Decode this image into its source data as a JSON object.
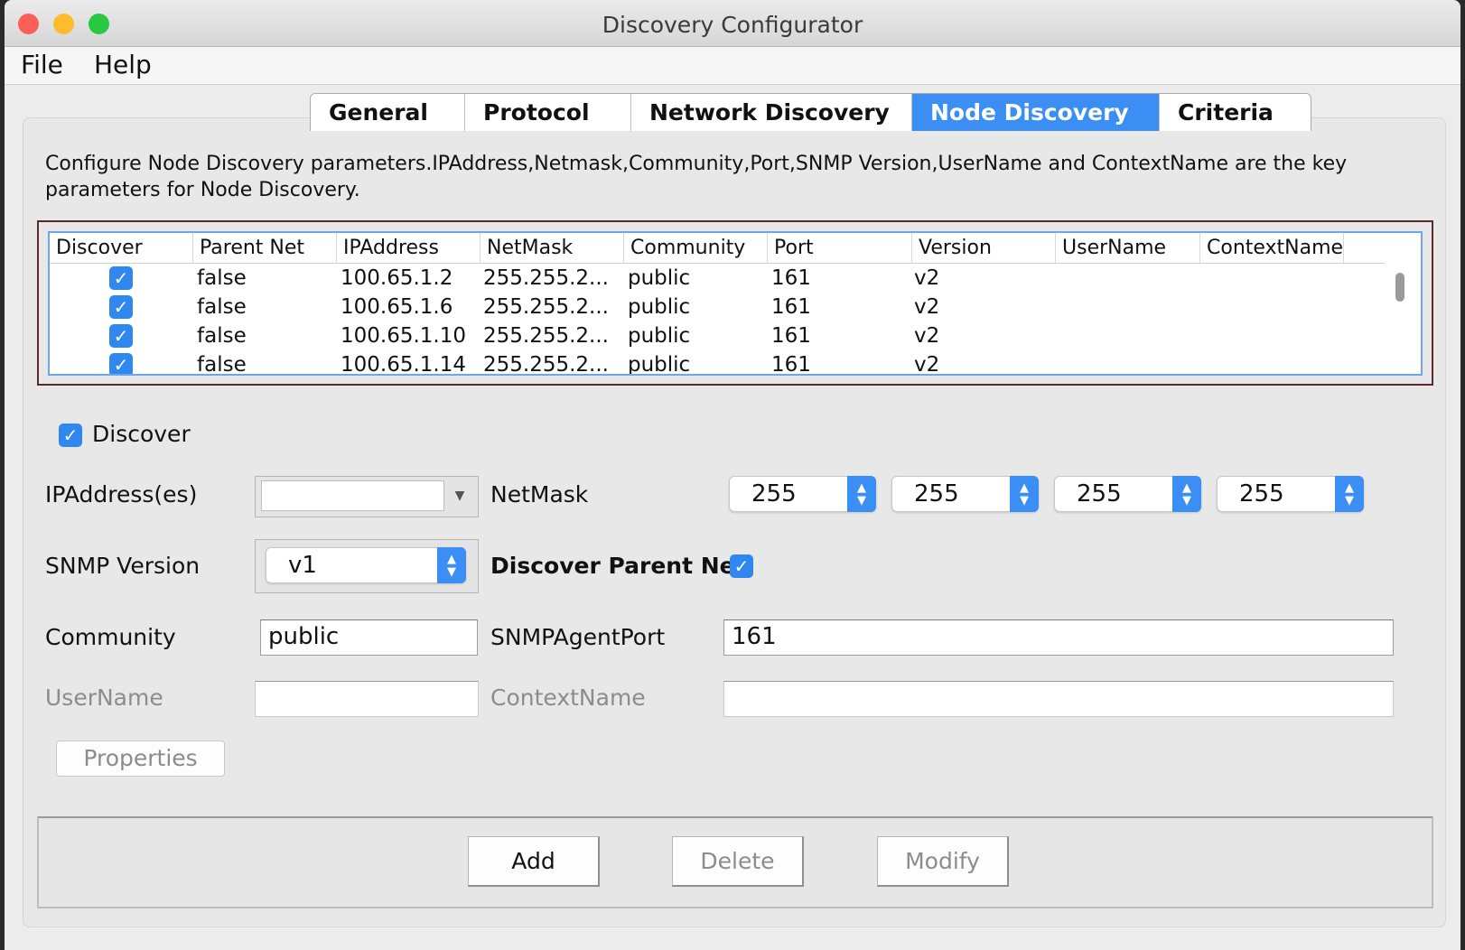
{
  "window": {
    "title": "Discovery Configurator",
    "traffic_lights": {
      "close": "#fc5f57",
      "minimize": "#fdbc2e",
      "zoom": "#28c840"
    }
  },
  "menu": {
    "file": "File",
    "help": "Help"
  },
  "tabs": [
    {
      "label": "General",
      "active": false
    },
    {
      "label": "Protocol",
      "active": false
    },
    {
      "label": "Network Discovery",
      "active": false
    },
    {
      "label": "Node Discovery",
      "active": true
    },
    {
      "label": "Criteria",
      "active": false
    }
  ],
  "description": "Configure Node Discovery parameters.IPAddress,Netmask,Community,Port,SNMP Version,UserName and ContextName are the key parameters for Node Discovery.",
  "table": {
    "columns": [
      "Discover",
      "Parent Net",
      "IPAddress",
      "NetMask",
      "Community",
      "Port",
      "Version",
      "UserName",
      "ContextName"
    ],
    "rows": [
      {
        "discover": true,
        "parent_net": "false",
        "ip": "100.65.1.2",
        "netmask": "255.255.2...",
        "community": "public",
        "port": "161",
        "version": "v2",
        "username": "",
        "contextname": ""
      },
      {
        "discover": true,
        "parent_net": "false",
        "ip": "100.65.1.6",
        "netmask": "255.255.2...",
        "community": "public",
        "port": "161",
        "version": "v2",
        "username": "",
        "contextname": ""
      },
      {
        "discover": true,
        "parent_net": "false",
        "ip": "100.65.1.10",
        "netmask": "255.255.2...",
        "community": "public",
        "port": "161",
        "version": "v2",
        "username": "",
        "contextname": ""
      },
      {
        "discover": true,
        "parent_net": "false",
        "ip": "100.65.1.14",
        "netmask": "255.255.2...",
        "community": "public",
        "port": "161",
        "version": "v2",
        "username": "",
        "contextname": ""
      }
    ]
  },
  "form": {
    "discover_label": "Discover",
    "discover_checked": true,
    "ip_label": "IPAddress(es)",
    "ip_value": "",
    "netmask_label": "NetMask",
    "netmask_octets": [
      "255",
      "255",
      "255",
      "255"
    ],
    "snmp_label": "SNMP Version",
    "snmp_value": "v1",
    "parent_net_label": "Discover Parent Net",
    "parent_net_checked": true,
    "community_label": "Community",
    "community_value": "public",
    "port_label": "SNMPAgentPort",
    "port_value": "161",
    "username_label": "UserName",
    "username_value": "",
    "context_label": "ContextName",
    "context_value": "",
    "properties_button": "Properties"
  },
  "actions": {
    "add": "Add",
    "delete": "Delete",
    "modify": "Modify"
  },
  "colors": {
    "accent": "#3a8ef4",
    "disabled_text": "#8c8c8c"
  },
  "icons": {
    "check": "✓",
    "dropdown": "▼",
    "spin_up": "▲",
    "spin_down": "▼"
  }
}
